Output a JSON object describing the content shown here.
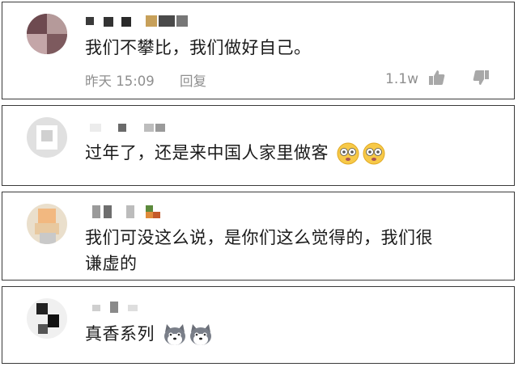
{
  "comments": [
    {
      "text": "我们不攀比，我们做好自己。",
      "time": "昨天 15:09",
      "reply_label": "回复",
      "like_count": "1.1w"
    },
    {
      "text": "过年了，还是来中国人家里做客",
      "emojis": [
        "dizzy-face",
        "dizzy-face"
      ]
    },
    {
      "text_line1": "我们可没这么说，是你们这么觉得的，我们很",
      "text_line2": "谦虚的"
    },
    {
      "text": "真香系列",
      "emojis": [
        "husky-dog",
        "husky-dog"
      ]
    }
  ],
  "colors": {
    "meta_gray": "#8f8f8f",
    "text": "#1a1a1a",
    "border": "#3a3a3a"
  }
}
